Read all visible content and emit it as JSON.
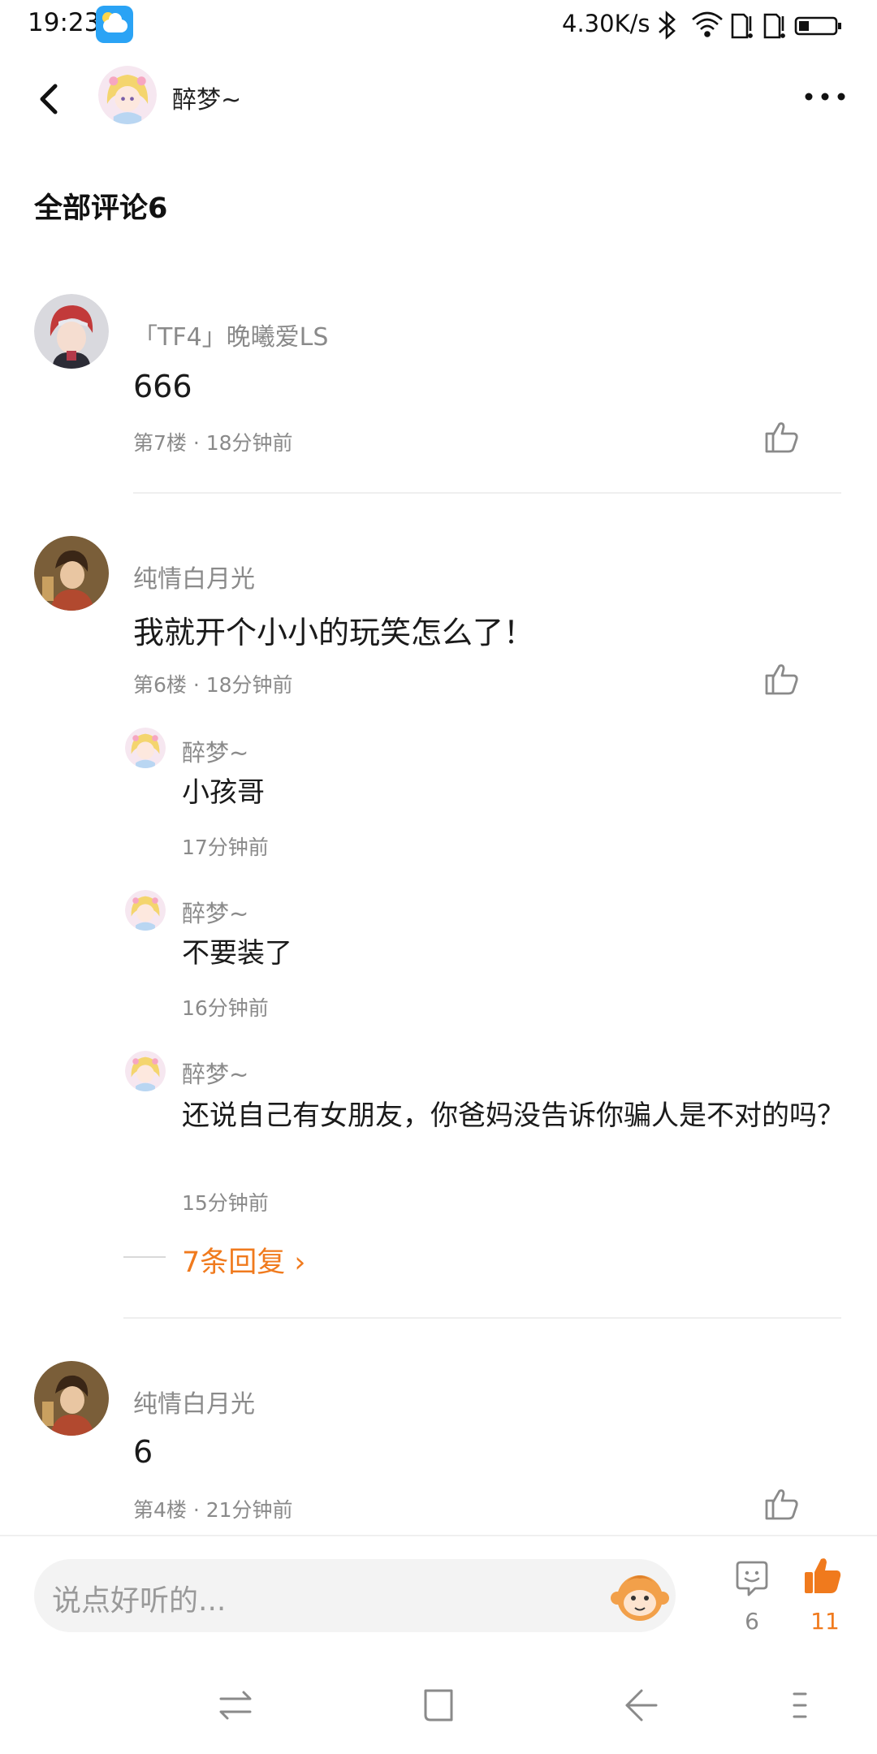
{
  "status_bar": {
    "time": "19:23",
    "network_speed": "4.30K/s",
    "icons": [
      "weather-icon",
      "bluetooth-icon",
      "wifi-icon",
      "sim1-icon",
      "sim2-icon",
      "battery-icon"
    ]
  },
  "header": {
    "user_name": "醉梦~",
    "icons": [
      "back-icon",
      "more-icon"
    ]
  },
  "section": {
    "title": "全部评论6"
  },
  "comments": [
    {
      "name": "「TF4」晚曦爱LS",
      "text": "666",
      "meta": "第7楼 · 18分钟前"
    },
    {
      "name": "纯情白月光",
      "text": "我就开个小小的玩笑怎么了！",
      "meta": "第6楼 · 18分钟前",
      "replies": [
        {
          "name": "醉梦~",
          "text": "小孩哥",
          "time": "17分钟前"
        },
        {
          "name": "醉梦~",
          "text": "不要装了",
          "time": "16分钟前"
        },
        {
          "name": "醉梦~",
          "text": "还说自己有女朋友，你爸妈没告诉你骗人是不对的吗？",
          "time": "15分钟前"
        }
      ],
      "more_replies": "7条回复 ›"
    },
    {
      "name": "纯情白月光",
      "text": "6",
      "meta": "第4楼 · 21分钟前"
    }
  ],
  "bottom_bar": {
    "input_placeholder": "说点好听的...",
    "comment_count": "6",
    "like_count": "11",
    "accent_color": "#f07a1d"
  },
  "nav_bar": {
    "icons": [
      "switch-icon",
      "home-square-icon",
      "back-arrow-icon",
      "menu-icon"
    ]
  }
}
